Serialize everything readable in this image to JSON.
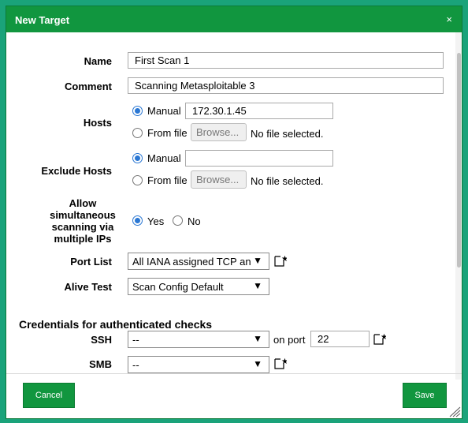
{
  "dialog": {
    "title": "New Target",
    "close_label": "×"
  },
  "form": {
    "name": {
      "label": "Name",
      "value": "First Scan 1"
    },
    "comment": {
      "label": "Comment",
      "value": "Scanning Metasploitable 3"
    },
    "hosts": {
      "label": "Hosts",
      "manual_label": "Manual",
      "manual_value": "172.30.1.45",
      "from_file_label": "From file",
      "browse_label": "Browse...",
      "no_file_label": "No file selected."
    },
    "exclude_hosts": {
      "label": "Exclude Hosts",
      "manual_label": "Manual",
      "manual_value": "",
      "from_file_label": "From file",
      "browse_label": "Browse...",
      "no_file_label": "No file selected."
    },
    "allow_simultaneous": {
      "label_lines": [
        "Allow",
        "simultaneous",
        "scanning via",
        "multiple IPs"
      ],
      "yes_label": "Yes",
      "no_label": "No"
    },
    "port_list": {
      "label": "Port List",
      "value": "All IANA assigned TCP an"
    },
    "alive_test": {
      "label": "Alive Test",
      "value": "Scan Config Default"
    }
  },
  "credentials": {
    "heading": "Credentials for authenticated checks",
    "ssh": {
      "label": "SSH",
      "value": "--",
      "on_port_label": "on port",
      "port_value": "22"
    },
    "smb": {
      "label": "SMB",
      "value": "--"
    }
  },
  "footer": {
    "cancel_label": "Cancel",
    "save_label": "Save"
  },
  "colors": {
    "accent": "#11963f",
    "background": "#1aa37a",
    "radio": "#2a77d3"
  }
}
